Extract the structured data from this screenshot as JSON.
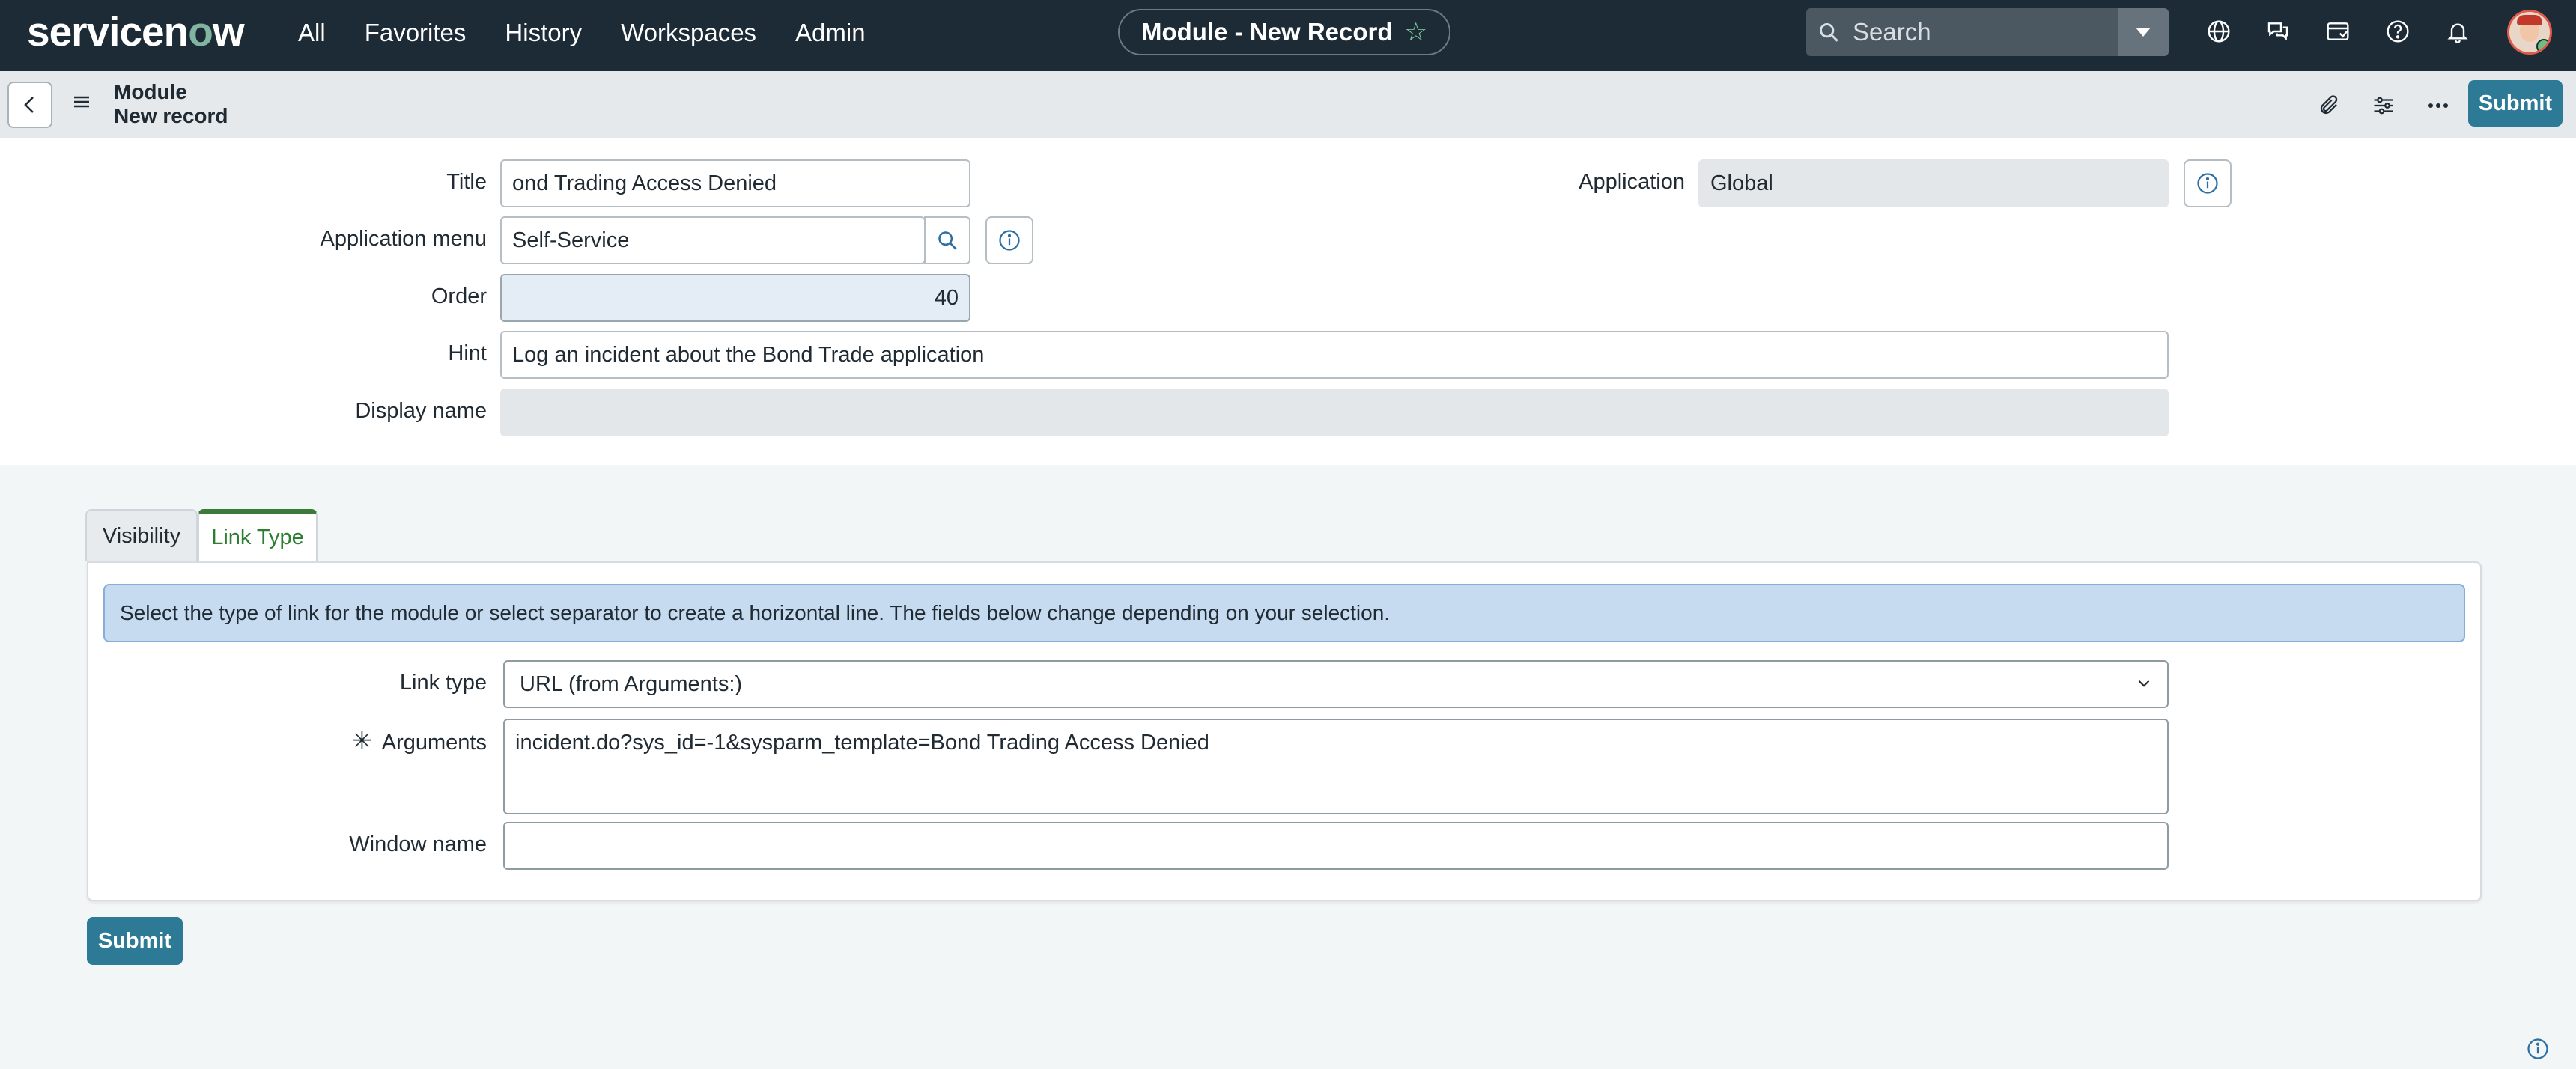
{
  "nav": {
    "logo_prefix": "servicen",
    "logo_o": "o",
    "logo_suffix": "w",
    "links": [
      "All",
      "Favorites",
      "History",
      "Workspaces",
      "Admin"
    ],
    "context_pill": "Module - New Record",
    "search_placeholder": "Search",
    "icons": [
      "globe-icon",
      "chat-icon",
      "inbox-icon",
      "help-icon",
      "bell-icon"
    ]
  },
  "subheader": {
    "title_line1": "Module",
    "title_line2": "New record",
    "submit_label": "Submit",
    "icons": [
      "paperclip-icon",
      "sliders-icon",
      "more-icon"
    ]
  },
  "form": {
    "title": {
      "label": "Title",
      "value": "ond Trading Access Denied"
    },
    "application": {
      "label": "Application",
      "value": "Global"
    },
    "application_menu": {
      "label": "Application menu",
      "value": "Self-Service"
    },
    "order": {
      "label": "Order",
      "value": "40"
    },
    "hint": {
      "label": "Hint",
      "value": "Log an incident about the Bond Trade application"
    },
    "display_name": {
      "label": "Display name",
      "value": ""
    }
  },
  "tabs": [
    {
      "label": "Visibility",
      "active": false
    },
    {
      "label": "Link Type",
      "active": true
    }
  ],
  "link_panel": {
    "info_text": "Select the type of link for the module or select separator to create a horizontal line. The fields below change depending on your selection.",
    "link_type": {
      "label": "Link type",
      "value": "URL (from Arguments:)"
    },
    "arguments": {
      "label": "Arguments",
      "required_marker": "✳",
      "value": "incident.do?sys_id=-1&sysparm_template=Bond Trading Access Denied"
    },
    "window_name": {
      "label": "Window name",
      "value": ""
    }
  },
  "bottom": {
    "submit_label": "Submit"
  },
  "colors": {
    "nav_bg": "#1c2b36",
    "primary_button": "#2d7a96",
    "active_tab": "#2e7d32",
    "info_bg": "#c6dbf0"
  }
}
